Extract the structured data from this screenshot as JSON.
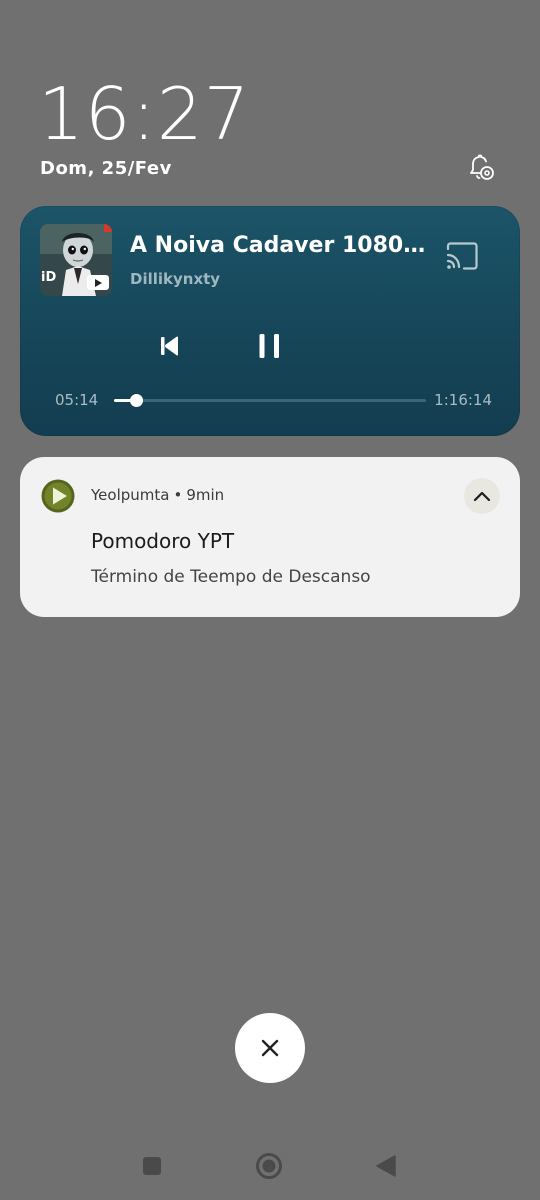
{
  "lockscreen": {
    "time": "16:27",
    "date": "Dom, 25/Fev"
  },
  "media": {
    "title": "A Noiva Cadaver 1080p r...",
    "artist": "Dillikynxty",
    "elapsed": "05:14",
    "duration": "1:16:14",
    "progress_fraction": 0.069,
    "art_badge_text": "iD",
    "icons": [
      "cast-icon",
      "skip-previous-icon",
      "pause-icon",
      "youtube-icon"
    ]
  },
  "notification": {
    "app_name": "Yeolpumta",
    "separator": "•",
    "time_ago": "9min",
    "title": "Pomodoro YPT",
    "text": "Término de Teempo de Descanso",
    "icon": "play-circle-icon",
    "expand_icon": "chevron-up-icon"
  },
  "colors": {
    "background": "#707070",
    "media_card": "#164659",
    "notif_card": "#f2f2f2",
    "app_icon_green": "#56641e"
  },
  "navbar": {
    "icons": [
      "recents-icon",
      "home-icon",
      "back-icon"
    ]
  }
}
